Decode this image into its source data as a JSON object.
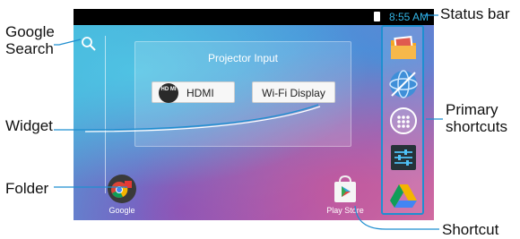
{
  "statusbar": {
    "time": "8:55 AM"
  },
  "widget": {
    "title": "Projector Input",
    "hdmi_label": "HDMI",
    "hdmi_logo": "HD MI",
    "wifi_label": "Wi-Fi Display"
  },
  "apps": {
    "google_label": "Google",
    "playstore_label": "Play Store"
  },
  "dock": {
    "icons": [
      "gallery-folder-icon",
      "globe-browser-icon",
      "app-drawer-icon",
      "settings-icon",
      "drive-icon"
    ]
  },
  "callouts": {
    "google_search": [
      "Google",
      "Search"
    ],
    "widget": "Widget",
    "folder": "Folder",
    "status_bar": "Status bar",
    "primary_shortcuts": [
      "Primary",
      "shortcuts"
    ],
    "shortcut": "Shortcut"
  },
  "colors": {
    "callout_line": "#1f8fd0",
    "clock": "#33b5e5",
    "dock_border": "#1f8fd0"
  }
}
